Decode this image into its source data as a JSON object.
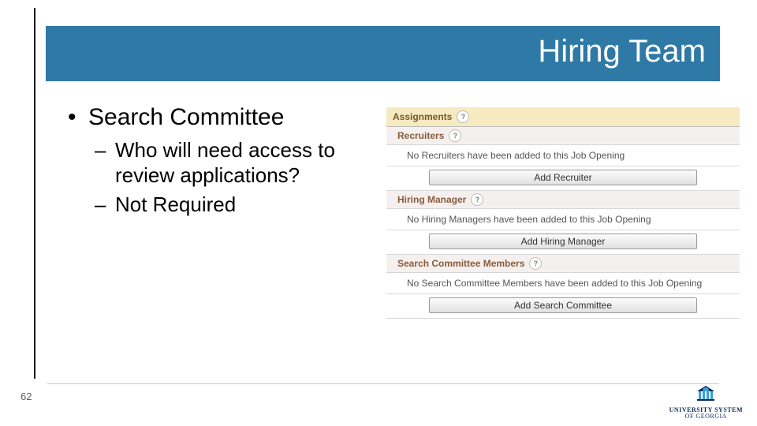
{
  "slide": {
    "title": "Hiring Team",
    "page_number": "62",
    "bullets": {
      "l1": "Search Committee",
      "l2": [
        "Who will need access to review applications?",
        "Not Required"
      ]
    }
  },
  "panel": {
    "assignments_label": "Assignments",
    "sections": [
      {
        "header": "Recruiters",
        "empty": "No Recruiters have been added to this Job Opening",
        "button": "Add Recruiter"
      },
      {
        "header": "Hiring Manager",
        "empty": "No Hiring Managers have been added to this Job Opening",
        "button": "Add Hiring Manager"
      },
      {
        "header": "Search Committee Members",
        "empty": "No Search Committee Members have been added to this Job Opening",
        "button": "Add Search Committee"
      }
    ]
  },
  "logo": {
    "line1": "UNIVERSITY SYSTEM",
    "line2": "OF GEORGIA"
  }
}
